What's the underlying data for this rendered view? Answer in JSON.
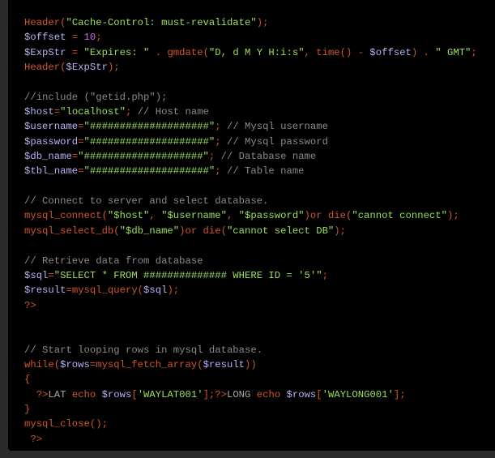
{
  "code_lines": [
    [
      [
        "Header(",
        "fn"
      ],
      [
        "\"Cache-Control: must-revalidate\"",
        "str"
      ],
      [
        ");",
        "fn"
      ]
    ],
    [
      [
        "$offset",
        "var"
      ],
      [
        " = ",
        "fn"
      ],
      [
        "10",
        "num"
      ],
      [
        ";",
        "fn"
      ]
    ],
    [
      [
        "$ExpStr",
        "var"
      ],
      [
        " = ",
        "fn"
      ],
      [
        "\"Expires: \"",
        "str"
      ],
      [
        " . gmdate(",
        "fn"
      ],
      [
        "\"D, d M Y H:i:s\"",
        "str"
      ],
      [
        ", time() - ",
        "fn"
      ],
      [
        "$offset",
        "var"
      ],
      [
        ") . ",
        "fn"
      ],
      [
        "\" GMT\"",
        "str"
      ],
      [
        ";",
        "fn"
      ]
    ],
    [
      [
        "Header(",
        "fn"
      ],
      [
        "$ExpStr",
        "var"
      ],
      [
        ");",
        "fn"
      ]
    ],
    [],
    [
      [
        "//include (\"getid.php\");",
        "cm"
      ]
    ],
    [
      [
        "$host",
        "var"
      ],
      [
        "=",
        "fn"
      ],
      [
        "\"localhost\"",
        "str"
      ],
      [
        "; ",
        "fn"
      ],
      [
        "// Host name",
        "cm"
      ]
    ],
    [
      [
        "$username",
        "var"
      ],
      [
        "=",
        "fn"
      ],
      [
        "\"####################\"",
        "str"
      ],
      [
        "; ",
        "fn"
      ],
      [
        "// Mysql username",
        "cm"
      ]
    ],
    [
      [
        "$password",
        "var"
      ],
      [
        "=",
        "fn"
      ],
      [
        "\"####################\"",
        "str"
      ],
      [
        "; ",
        "fn"
      ],
      [
        "// Mysql password",
        "cm"
      ]
    ],
    [
      [
        "$db_name",
        "var"
      ],
      [
        "=",
        "fn"
      ],
      [
        "\"####################\"",
        "str"
      ],
      [
        "; ",
        "fn"
      ],
      [
        "// Database name",
        "cm"
      ]
    ],
    [
      [
        "$tbl_name",
        "var"
      ],
      [
        "=",
        "fn"
      ],
      [
        "\"####################\"",
        "str"
      ],
      [
        "; ",
        "fn"
      ],
      [
        "// Table name",
        "cm"
      ]
    ],
    [],
    [
      [
        "// Connect to server and select database.",
        "cm"
      ]
    ],
    [
      [
        "mysql_connect(",
        "fn"
      ],
      [
        "\"$host\"",
        "str"
      ],
      [
        ", ",
        "fn"
      ],
      [
        "\"$username\"",
        "str"
      ],
      [
        ", ",
        "fn"
      ],
      [
        "\"$password\"",
        "str"
      ],
      [
        ")or die(",
        "fn"
      ],
      [
        "\"cannot connect\"",
        "str"
      ],
      [
        ");",
        "fn"
      ]
    ],
    [
      [
        "mysql_select_db(",
        "fn"
      ],
      [
        "\"$db_name\"",
        "str"
      ],
      [
        ")or die(",
        "fn"
      ],
      [
        "\"cannot select DB\"",
        "str"
      ],
      [
        ");",
        "fn"
      ]
    ],
    [],
    [
      [
        "// Retrieve data from database",
        "cm"
      ]
    ],
    [
      [
        "$sql",
        "var"
      ],
      [
        "=",
        "fn"
      ],
      [
        "\"SELECT * FROM ############## WHERE ID = '5'\"",
        "str"
      ],
      [
        ";",
        "fn"
      ]
    ],
    [
      [
        "$result",
        "var"
      ],
      [
        "=mysql_query(",
        "fn"
      ],
      [
        "$sql",
        "var"
      ],
      [
        ");",
        "fn"
      ]
    ],
    [
      [
        "?>",
        "fn"
      ]
    ],
    [],
    [],
    [
      [
        "// Start looping rows in mysql database.",
        "cm"
      ]
    ],
    [
      [
        "while(",
        "fn"
      ],
      [
        "$rows",
        "var"
      ],
      [
        "=mysql_fetch_array(",
        "fn"
      ],
      [
        "$result",
        "var"
      ],
      [
        "))",
        "fn"
      ]
    ],
    [
      [
        "{",
        "fn"
      ]
    ],
    [
      [
        "  ?>",
        "fn"
      ],
      [
        "LAT ",
        "txt"
      ],
      [
        "echo ",
        "fn"
      ],
      [
        "$rows",
        "var"
      ],
      [
        "[",
        "fn"
      ],
      [
        "'WAYLAT001'",
        "str"
      ],
      [
        "];?>",
        "fn"
      ],
      [
        "LONG ",
        "txt"
      ],
      [
        "echo ",
        "fn"
      ],
      [
        "$rows",
        "var"
      ],
      [
        "[",
        "fn"
      ],
      [
        "'WAYLONG001'",
        "str"
      ],
      [
        "];",
        "fn"
      ]
    ],
    [
      [
        "}",
        "fn"
      ]
    ],
    [
      [
        "mysql_close();",
        "fn"
      ]
    ],
    [
      [
        " ?>",
        "fn"
      ]
    ]
  ]
}
